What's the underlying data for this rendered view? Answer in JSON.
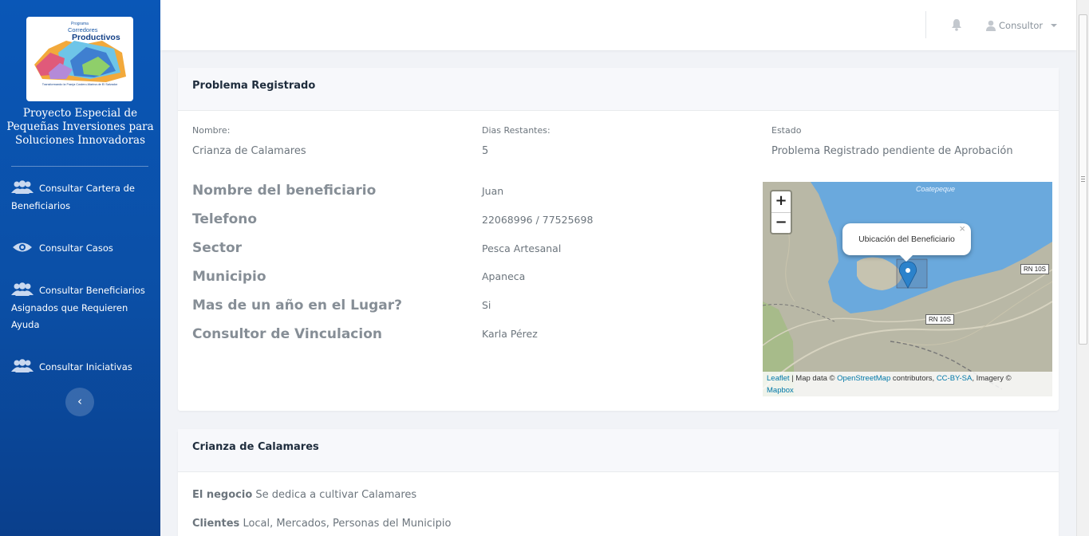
{
  "sidebar": {
    "logo": {
      "program": "Programa",
      "line1": "Corredores",
      "line2": "Productivos",
      "tagline": "Transformando la Franja Costero-Marina de El Salvador"
    },
    "title": "Proyecto Especial de Pequeñas Inversiones para Soluciones Innovadoras",
    "items": [
      {
        "label_a": "Consultar Cartera de",
        "label_b": "Beneficiarios",
        "icon": "users-icon"
      },
      {
        "label": "Consultar Casos",
        "icon": "eye-icon"
      },
      {
        "label_a": "Consultar Beneficiarios",
        "label_b": "Asignados que Requieren",
        "label_c": "Ayuda",
        "icon": "users-icon"
      },
      {
        "label": "Consultar Iniciativas",
        "icon": "users-icon"
      }
    ],
    "collapse_glyph": "‹"
  },
  "header": {
    "user": "Consultor"
  },
  "problem": {
    "title": "Problema Registrado",
    "summary": [
      {
        "label": "Nombre:",
        "value": "Crianza de Calamares"
      },
      {
        "label": "Dias Restantes:",
        "value": "5"
      },
      {
        "label": "Estado",
        "value": "Problema Registrado pendiente de Aprobación"
      }
    ],
    "details": [
      {
        "label": "Nombre del beneficiario",
        "value": "Juan"
      },
      {
        "label": "Telefono",
        "value": "22068996 / 77525698"
      },
      {
        "label": "Sector",
        "value": "Pesca Artesanal"
      },
      {
        "label": "Municipio",
        "value": "Apaneca"
      },
      {
        "label": "Mas de un año en el Lugar?",
        "value": "Si"
      },
      {
        "label": "Consultor de Vinculacion",
        "value": "Karla Pérez"
      }
    ]
  },
  "map": {
    "zoom_in": "+",
    "zoom_out": "−",
    "popup": "Ubicación del Beneficiario",
    "popup_close": "×",
    "lake": "Coatepeque",
    "road_labels": [
      "RN 10S",
      "RN 10S"
    ],
    "attribution": {
      "leaflet": "Leaflet",
      "sep1": " | Map data © ",
      "osm": "OpenStreetMap",
      "sep2": " contributors, ",
      "license": "CC-BY-SA",
      "sep3": ", Imagery © ",
      "mapbox": "Mapbox"
    }
  },
  "business": {
    "title": "Crianza de Calamares",
    "rows": [
      {
        "label": "El negocio",
        "value": "Se dedica a cultivar Calamares"
      },
      {
        "label": "Clientes",
        "value": "Local, Mercados, Personas del Municipio"
      }
    ]
  }
}
